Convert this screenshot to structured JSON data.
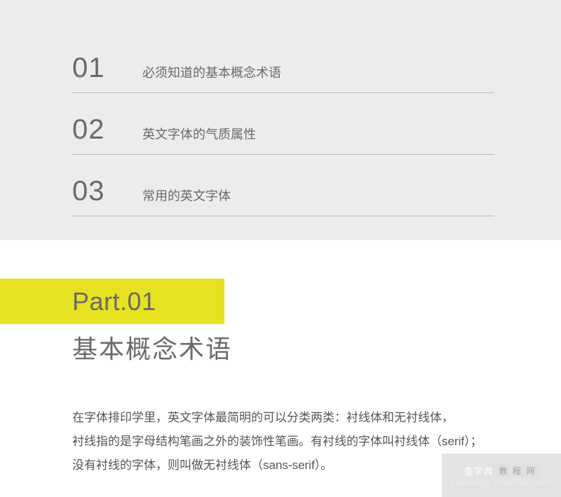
{
  "toc": {
    "items": [
      {
        "number": "01",
        "title": "必须知道的基本概念术语"
      },
      {
        "number": "02",
        "title": "英文字体的气质属性"
      },
      {
        "number": "03",
        "title": "常用的英文字体"
      }
    ]
  },
  "part": {
    "label": "Part.01",
    "title": "基本概念术语"
  },
  "body": {
    "line1": "在字体排印学里，英文字体最简明的可以分类两类：衬线体和无衬线体，",
    "line2": "衬线指的是字母结构笔画之外的装饰性笔画。有衬线的字体叫衬线体（serif）；",
    "line3": "没有衬线的字体，则叫做无衬线体（sans-serif）。"
  },
  "watermark": {
    "brand": "查字典",
    "badge": "教 程 网",
    "url": "jiaocheng.chazidian.com"
  }
}
